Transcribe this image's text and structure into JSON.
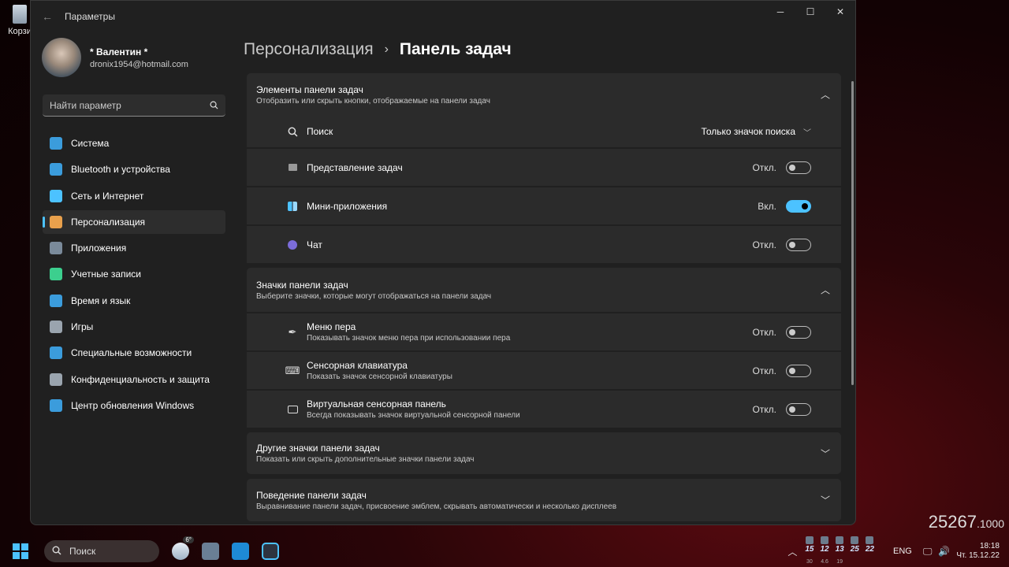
{
  "desktop": {
    "recycle_bin_label": "Корзи",
    "build": "25267",
    "build_suffix": ".1000"
  },
  "window": {
    "title": "Параметры"
  },
  "profile": {
    "name": "* Валентин *",
    "email": "dronix1954@hotmail.com"
  },
  "search": {
    "placeholder": "Найти параметр"
  },
  "sidebar": {
    "items": [
      {
        "label": "Система",
        "icon": "monitor-icon",
        "color": "#3b9cdc"
      },
      {
        "label": "Bluetooth и устройства",
        "icon": "bluetooth-icon",
        "color": "#3b9cdc"
      },
      {
        "label": "Сеть и Интернет",
        "icon": "wifi-icon",
        "color": "#4cc2ff"
      },
      {
        "label": "Персонализация",
        "icon": "brush-icon",
        "color": "#e8a04c",
        "active": true
      },
      {
        "label": "Приложения",
        "icon": "apps-icon",
        "color": "#7a8a9a"
      },
      {
        "label": "Учетные записи",
        "icon": "person-icon",
        "color": "#3ccf8e"
      },
      {
        "label": "Время и язык",
        "icon": "globe-icon",
        "color": "#3b9cdc"
      },
      {
        "label": "Игры",
        "icon": "gamepad-icon",
        "color": "#9aa4ae"
      },
      {
        "label": "Специальные возможности",
        "icon": "accessibility-icon",
        "color": "#3b9cdc"
      },
      {
        "label": "Конфиденциальность и защита",
        "icon": "shield-icon",
        "color": "#9aa4ae"
      },
      {
        "label": "Центр обновления Windows",
        "icon": "update-icon",
        "color": "#3b9cdc"
      }
    ]
  },
  "breadcrumb": {
    "parent": "Персонализация",
    "separator": "›",
    "current": "Панель задач"
  },
  "sections": {
    "taskbar_items": {
      "title": "Элементы панели задач",
      "subtitle": "Отобразить или скрыть кнопки, отображаемые на панели задач",
      "search": {
        "label": "Поиск",
        "value": "Только значок поиска"
      },
      "task_view": {
        "label": "Представление задач",
        "state": "Откл."
      },
      "widgets": {
        "label": "Мини-приложения",
        "state": "Вкл."
      },
      "chat": {
        "label": "Чат",
        "state": "Откл."
      }
    },
    "taskbar_icons": {
      "title": "Значки панели задач",
      "subtitle": "Выберите значки, которые могут отображаться на панели задач",
      "pen_menu": {
        "label": "Меню пера",
        "sub": "Показывать значок меню пера при использовании пера",
        "state": "Откл."
      },
      "touch_keyboard": {
        "label": "Сенсорная клавиатура",
        "sub": "Показать значок сенсорной клавиатуры",
        "state": "Откл."
      },
      "touchpad": {
        "label": "Виртуальная сенсорная панель",
        "sub": "Всегда показывать значок виртуальной сенсорной панели",
        "state": "Откл."
      }
    },
    "other_icons": {
      "title": "Другие значки панели задач",
      "subtitle": "Показать или скрыть дополнительные значки панели задач"
    },
    "behavior": {
      "title": "Поведение панели задач",
      "subtitle": "Выравнивание панели задач, присвоение эмблем, скрывать автоматически и несколько дисплеев"
    }
  },
  "taskbar": {
    "search_label": "Поиск",
    "weather_badge": "6°",
    "tray_numbers": [
      {
        "big": "15",
        "small": "30"
      },
      {
        "big": "12",
        "small": "4.6"
      },
      {
        "big": "13",
        "small": "19"
      },
      {
        "big": "25",
        "small": ""
      },
      {
        "big": "22",
        "small": ""
      }
    ],
    "lang": "ENG",
    "time": "18:18",
    "date": "Чт. 15.12.22"
  }
}
